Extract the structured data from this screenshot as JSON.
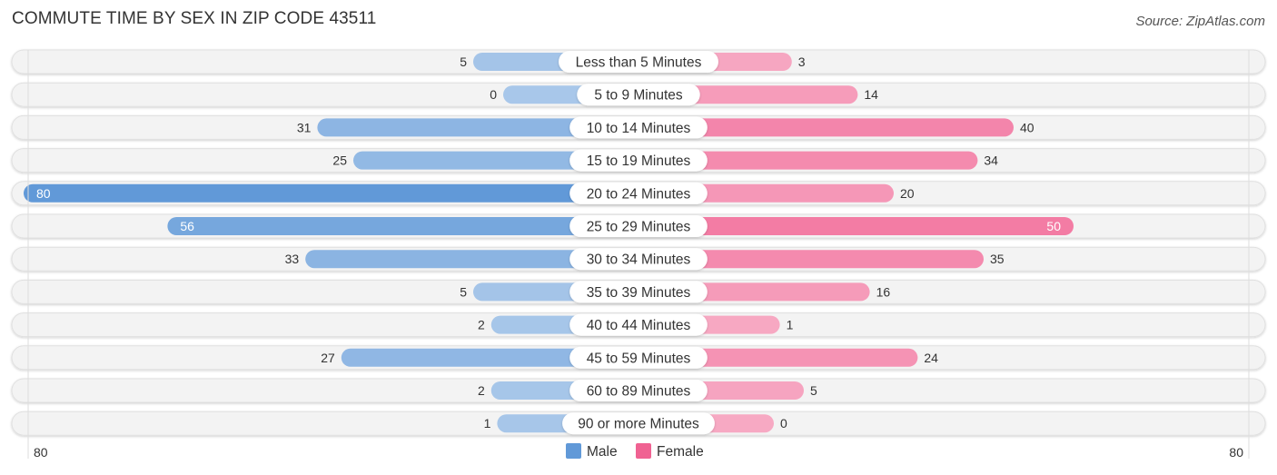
{
  "chart_data": {
    "type": "bar",
    "orientation": "horizontal-diverging",
    "title": "COMMUTE TIME BY SEX IN ZIP CODE 43511",
    "source": "Source: ZipAtlas.com",
    "categories": [
      "Less than 5 Minutes",
      "5 to 9 Minutes",
      "10 to 14 Minutes",
      "15 to 19 Minutes",
      "20 to 24 Minutes",
      "25 to 29 Minutes",
      "30 to 34 Minutes",
      "35 to 39 Minutes",
      "40 to 44 Minutes",
      "45 to 59 Minutes",
      "60 to 89 Minutes",
      "90 or more Minutes"
    ],
    "series": [
      {
        "name": "Male",
        "color": "#6199d8",
        "values": [
          5,
          0,
          31,
          25,
          80,
          56,
          33,
          5,
          2,
          27,
          2,
          1
        ]
      },
      {
        "name": "Female",
        "color": "#f06292",
        "values": [
          3,
          14,
          40,
          34,
          20,
          50,
          35,
          16,
          1,
          24,
          5,
          0
        ]
      }
    ],
    "axis": {
      "left_tick": "80",
      "right_tick": "80",
      "max": 80
    },
    "legend": {
      "position": "bottom-center",
      "items": [
        "Male",
        "Female"
      ]
    }
  }
}
